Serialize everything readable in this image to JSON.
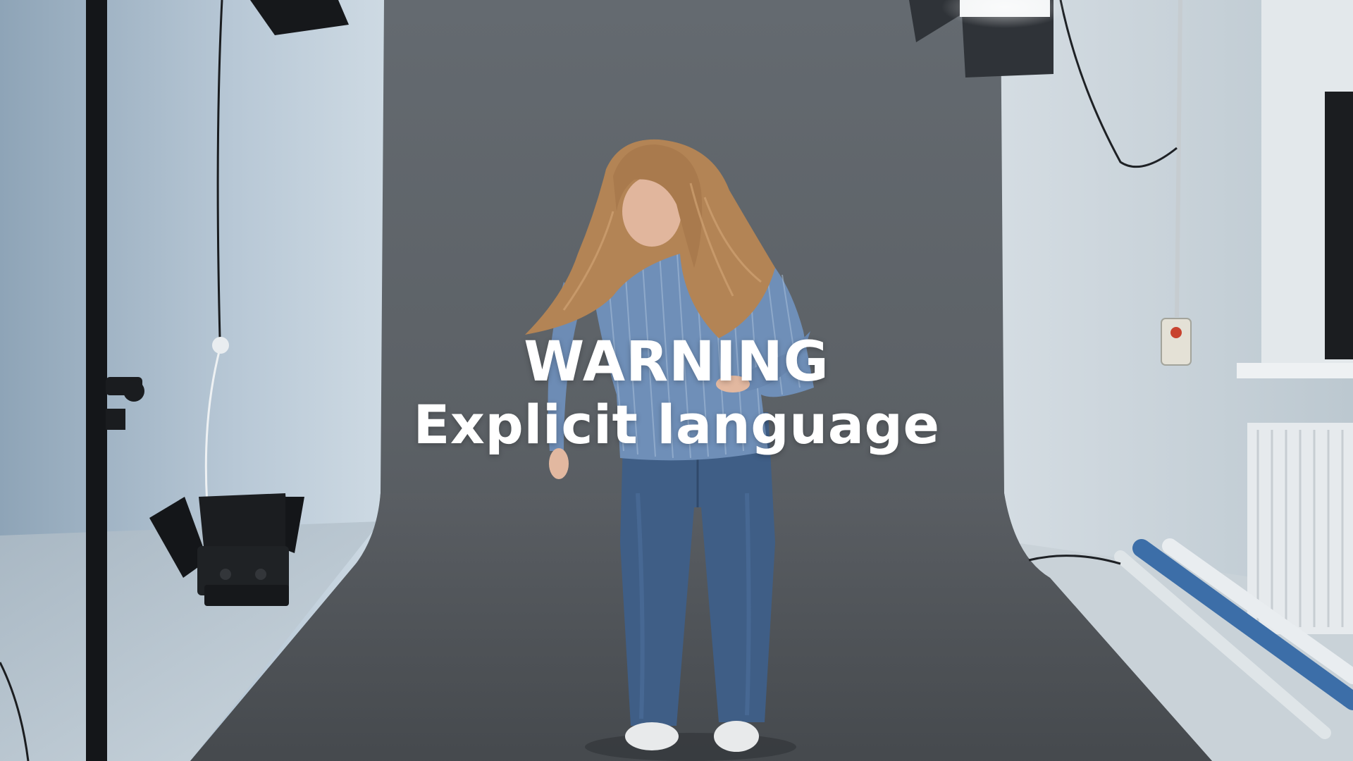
{
  "overlay": {
    "title": "WARNING",
    "subtitle": "Explicit language"
  },
  "colors": {
    "backdrop_gray": "#5d6165",
    "wall_left": "#b9c6d0",
    "wall_right": "#d6dde2",
    "shirt_blue": "#6f8fb8",
    "jeans_blue": "#3f5e86",
    "hair": "#b58657",
    "text": "#ffffff"
  }
}
